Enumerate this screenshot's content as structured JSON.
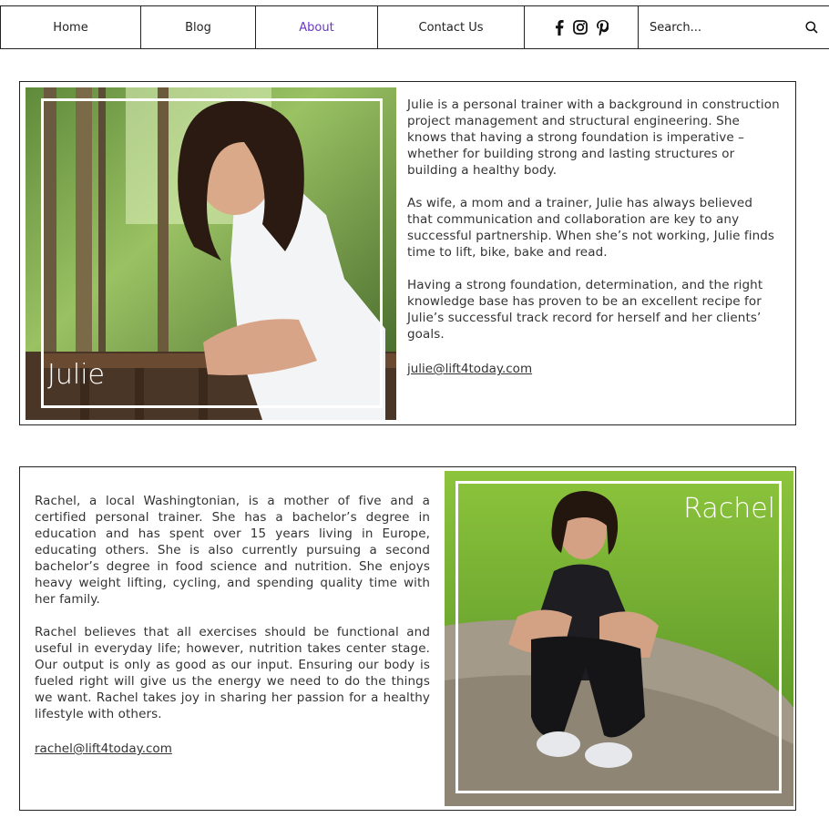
{
  "nav": {
    "items": [
      {
        "label": "Home",
        "active": false
      },
      {
        "label": "Blog",
        "active": false
      },
      {
        "label": "About",
        "active": true
      },
      {
        "label": "Contact Us",
        "active": false
      }
    ],
    "social_icons": [
      "facebook-icon",
      "instagram-icon",
      "pinterest-icon"
    ],
    "search_placeholder": "Search..."
  },
  "julie": {
    "name": "Julie",
    "paragraphs": [
      "Julie is a personal trainer with a background in construction project management and structural engineering. She knows that having a strong foundation is imperative – whether for building strong and lasting structures or building a healthy body.",
      "As wife, a mom and a trainer, Julie has always believed that communication and collaboration are key to any successful partnership.  When she’s not working, Julie finds time to lift, bike, bake and read.",
      "Having a strong foundation, determination, and the right knowledge base has proven to be an excellent recipe for Julie’s successful track record for herself and her clients’ goals."
    ],
    "email": "julie@lift4today.com"
  },
  "rachel": {
    "name": "Rachel",
    "paragraphs": [
      "Rachel, a local Washingtonian, is a mother of five and a certified personal trainer. She has a bachelor’s degree in education and has spent over 15 years living in Europe, educating others. She is also currently pursuing a second bachelor’s degree in food science and nutrition. She enjoys heavy weight lifting, cycling, and spending quality time with her family.",
      "Rachel believes that all exercises should be functional and useful in everyday life; however, nutrition takes center stage. Our output is only as good as our input. Ensuring our body is fueled right will give us the energy we need to do the things we want. Rachel takes joy in sharing her passion for a healthy lifestyle with others."
    ],
    "email": "rachel@lift4today.com"
  }
}
